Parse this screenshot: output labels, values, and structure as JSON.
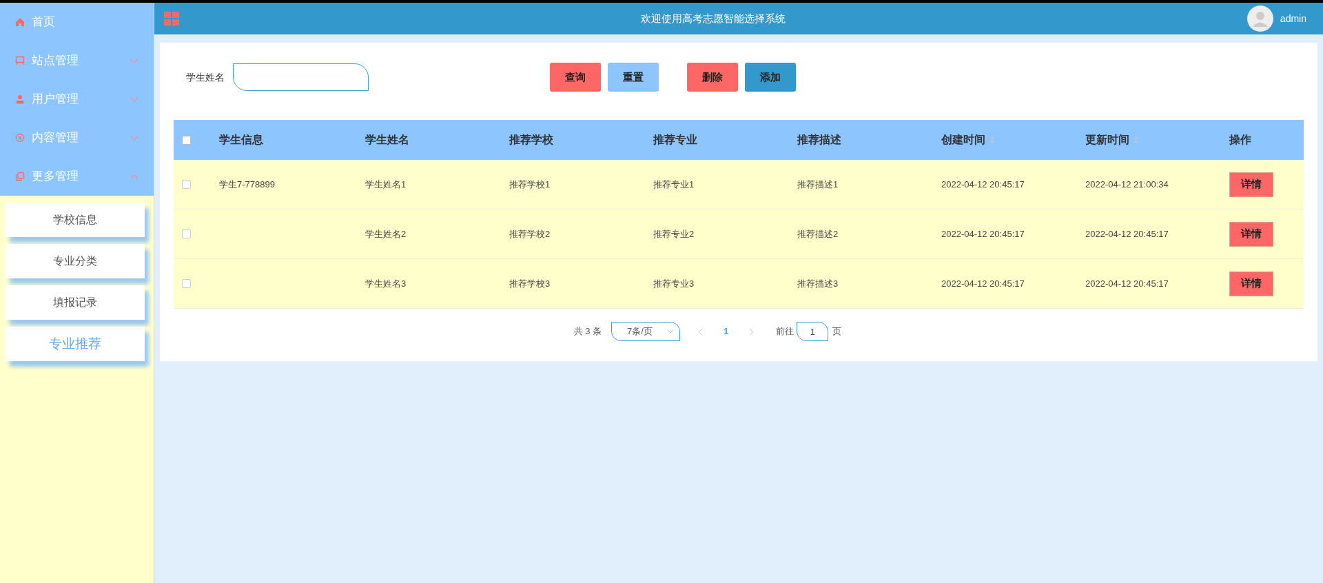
{
  "header": {
    "title": "欢迎使用高考志愿智能选择系统",
    "user": "admin"
  },
  "sidebar": {
    "items": [
      {
        "label": "首页"
      },
      {
        "label": "站点管理",
        "expanded": false
      },
      {
        "label": "用户管理",
        "expanded": false
      },
      {
        "label": "内容管理",
        "expanded": false
      },
      {
        "label": "更多管理",
        "expanded": true,
        "children": [
          {
            "label": "学校信息",
            "selected": false
          },
          {
            "label": "专业分类",
            "selected": false
          },
          {
            "label": "填报记录",
            "selected": false
          },
          {
            "label": "专业推荐",
            "selected": true
          }
        ]
      }
    ]
  },
  "search": {
    "label": "学生姓名"
  },
  "buttons": [
    {
      "label": "查询",
      "kind": "danger"
    },
    {
      "label": "重置",
      "kind": "light"
    },
    {
      "label": "删除",
      "kind": "danger"
    },
    {
      "label": "添加",
      "kind": "primary"
    }
  ],
  "table": {
    "select_all": false,
    "columns": [
      {
        "label": "学生信息",
        "sortable": false
      },
      {
        "label": "学生姓名",
        "sortable": false
      },
      {
        "label": "推荐学校",
        "sortable": false
      },
      {
        "label": "推荐专业",
        "sortable": false
      },
      {
        "label": "推荐描述",
        "sortable": false
      },
      {
        "label": "创建时间",
        "sortable": true
      },
      {
        "label": "更新时间",
        "sortable": true
      },
      {
        "label": "操作",
        "sortable": false
      }
    ],
    "rows": [
      {
        "checked": false,
        "cells": [
          "学生7-778899",
          "学生姓名1",
          "推荐学校1",
          "推荐专业1",
          "推荐描述1",
          "2022-04-12 20:45:17",
          "2022-04-12 21:00:34"
        ],
        "action": "详情"
      },
      {
        "checked": false,
        "cells": [
          "",
          "学生姓名2",
          "推荐学校2",
          "推荐专业2",
          "推荐描述2",
          "2022-04-12 20:45:17",
          "2022-04-12 20:45:17"
        ],
        "action": "详情"
      },
      {
        "checked": false,
        "cells": [
          "",
          "学生姓名3",
          "推荐学校3",
          "推荐专业3",
          "推荐描述3",
          "2022-04-12 20:45:17",
          "2022-04-12 20:45:17"
        ],
        "action": "详情"
      }
    ]
  },
  "pagination": {
    "total": "共 3 条",
    "page_size": "7条/页",
    "pages": [
      {
        "label": "1",
        "selected": true
      }
    ],
    "goto_label": "前往",
    "goto_value": "1",
    "goto_suffix": "页"
  }
}
